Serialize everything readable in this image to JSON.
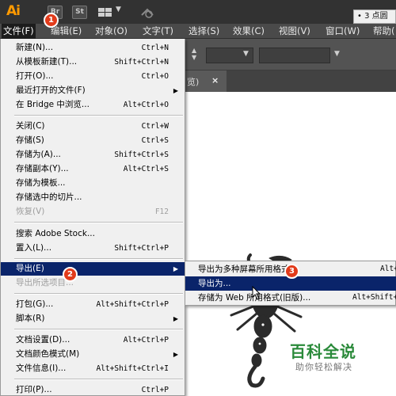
{
  "app": {
    "logo": "Ai",
    "toolbar_icons": {
      "bridge": "Br",
      "stock": "St"
    }
  },
  "menubar": {
    "items": [
      {
        "label": "文件(F)"
      },
      {
        "label": "编辑(E)"
      },
      {
        "label": "对象(O)"
      },
      {
        "label": "文字(T)"
      },
      {
        "label": "选择(S)"
      },
      {
        "label": "效果(C)"
      },
      {
        "label": "视图(V)"
      },
      {
        "label": "窗口(W)"
      },
      {
        "label": "帮助("
      }
    ]
  },
  "control_bar": {
    "stroke_label": "3 点圆"
  },
  "document_tab": {
    "label": "览)",
    "close": "×"
  },
  "file_menu": {
    "items": [
      {
        "label": "新建(N)...",
        "shortcut": "Ctrl+N"
      },
      {
        "label": "从模板新建(T)...",
        "shortcut": "Shift+Ctrl+N"
      },
      {
        "label": "打开(O)...",
        "shortcut": "Ctrl+O"
      },
      {
        "label": "最近打开的文件(F)",
        "shortcut": ""
      },
      {
        "label": "在 Bridge 中浏览...",
        "shortcut": "Alt+Ctrl+O"
      },
      {
        "label": "关闭(C)",
        "shortcut": "Ctrl+W"
      },
      {
        "label": "存储(S)",
        "shortcut": "Ctrl+S"
      },
      {
        "label": "存储为(A)...",
        "shortcut": "Shift+Ctrl+S"
      },
      {
        "label": "存储副本(Y)...",
        "shortcut": "Alt+Ctrl+S"
      },
      {
        "label": "存储为模板...",
        "shortcut": ""
      },
      {
        "label": "存储选中的切片...",
        "shortcut": ""
      },
      {
        "label": "恢复(V)",
        "shortcut": "F12"
      },
      {
        "label": "搜索 Adobe Stock...",
        "shortcut": ""
      },
      {
        "label": "置入(L)...",
        "shortcut": "Shift+Ctrl+P"
      },
      {
        "label": "导出(E)",
        "shortcut": ""
      },
      {
        "label": "导出所选项目...",
        "shortcut": ""
      },
      {
        "label": "打包(G)...",
        "shortcut": "Alt+Shift+Ctrl+P"
      },
      {
        "label": "脚本(R)",
        "shortcut": ""
      },
      {
        "label": "文档设置(D)...",
        "shortcut": "Alt+Ctrl+P"
      },
      {
        "label": "文档颜色模式(M)",
        "shortcut": ""
      },
      {
        "label": "文件信息(I)...",
        "shortcut": "Alt+Shift+Ctrl+I"
      },
      {
        "label": "打印(P)...",
        "shortcut": "Ctrl+P"
      }
    ]
  },
  "export_submenu": {
    "items": [
      {
        "label": "导出为多种屏幕所用格式...",
        "shortcut": "Alt+"
      },
      {
        "label": "导出为...",
        "shortcut": ""
      },
      {
        "label": "存储为 Web 所用格式(旧版)...",
        "shortcut": "Alt+Shift+"
      }
    ]
  },
  "step_badges": [
    "1",
    "2",
    "3"
  ],
  "watermark": {
    "title": "百科全说",
    "subtitle": "助你轻松解决"
  },
  "colors": {
    "menu_highlight": "#0a246a",
    "badge": "#e23b1b",
    "ai_logo": "#ff9a00",
    "watermark": "#2a8a3a"
  },
  "icons": [
    "bridge-icon",
    "stock-icon",
    "workspace-layout-icon",
    "chevron-down-icon",
    "sync-icon",
    "submenu-arrow-icon",
    "close-icon",
    "mouse-cursor-icon",
    "scorpion-illustration"
  ]
}
